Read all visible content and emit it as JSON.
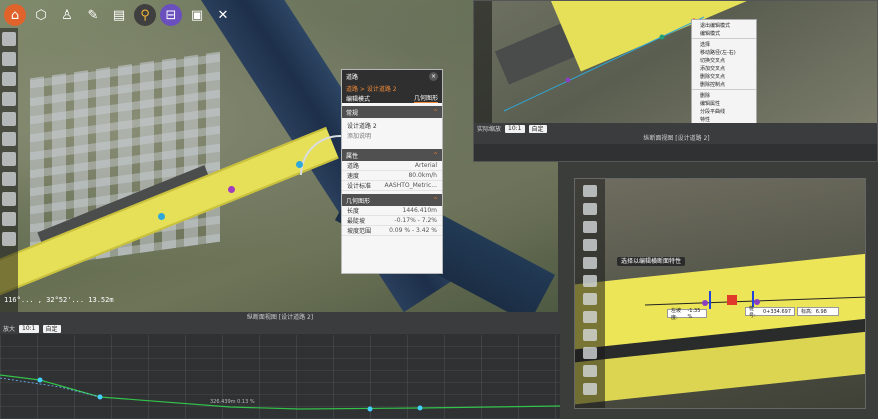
{
  "colors": {
    "accent": "#e0632b",
    "road": "#e6df58",
    "panel_header": "#2f2f2f",
    "section_header": "#505050",
    "profile_bg": "#2f3133"
  },
  "toolbar": {
    "icons": [
      "home-icon",
      "cube-icon",
      "walk-icon",
      "pen-icon",
      "measure-icon",
      "road-icon",
      "camera-icon",
      "tools-icon"
    ]
  },
  "status": {
    "coords": "116°... , 32°52'... 13.52m"
  },
  "properties": {
    "title": "道路",
    "breadcrumb": "道路 > 设计道路 2",
    "tab_left": "编辑模式",
    "tab_right": "几何图形",
    "sections": {
      "general": "常规",
      "name": "设计道路 2",
      "add_desc": "添加说明",
      "attributes": "属性",
      "geometry": "几何图形"
    },
    "attr_rows": [
      {
        "label": "道路",
        "value": "Arterial"
      },
      {
        "label": "速度",
        "value": "80.0km/h"
      },
      {
        "label": "设计标准",
        "value": "AASHTO_Metric..."
      }
    ],
    "geo_rows": [
      {
        "label": "长度",
        "value": "1446.410m"
      },
      {
        "label": "最陡坡",
        "value": "-0.17% - 7.2%"
      },
      {
        "label": "坡度范围",
        "value": "0.09 % - 3.42 %"
      }
    ]
  },
  "profile": {
    "title": "纵断面视图 [设计道路 2]",
    "zoom_label": "放大",
    "zoom_value": "10:1",
    "mode_value": "自定",
    "annotation": "326.439m 0.13 %"
  },
  "inset1": {
    "context_menu": [
      "退出编辑模式",
      "编辑模式",
      "",
      "选择",
      "移动路径(左-右)",
      "切换交叉点",
      "添加交叉点",
      "删除交叉点",
      "删除控制点",
      "",
      "删除",
      "编辑属性",
      "分段平曲线",
      "特性"
    ],
    "profile_title": "纵断面视图 [设计道路 2]",
    "zoom_label": "实际缩放",
    "zoom_value": "10:1",
    "mode_value": "自定"
  },
  "inset2": {
    "tooltip": "选择以编辑横断面特性",
    "field1_label": "左坡度:",
    "field1_value": "-1.35 %",
    "field2_label": "桩号:",
    "field2_value": "0+334.697",
    "field3_label": "标高:",
    "field3_value": "6.98"
  }
}
